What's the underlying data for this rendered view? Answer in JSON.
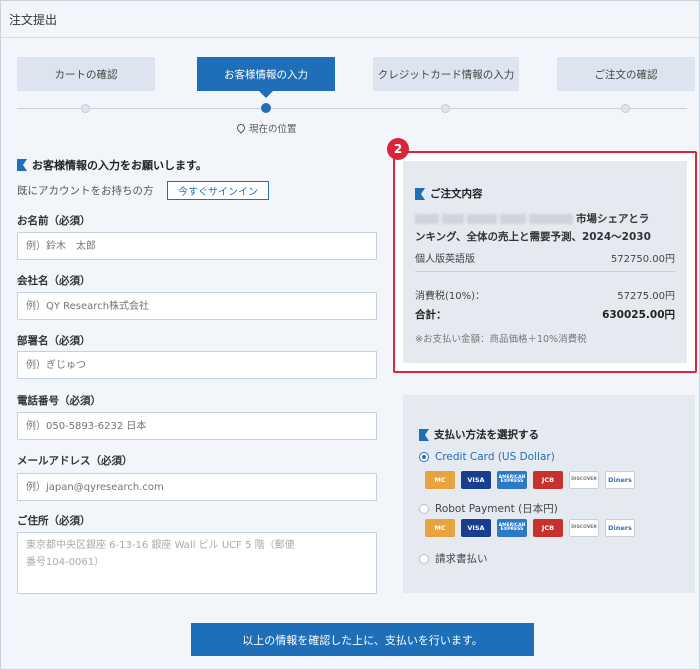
{
  "page": {
    "title": "注文提出"
  },
  "steps": [
    {
      "label": "カートの確認"
    },
    {
      "label": "お客様情報の入力"
    },
    {
      "label": "クレジットカード情報の入力"
    },
    {
      "label": "ご注文の確認"
    }
  ],
  "progress": {
    "current_label": "現在の位置",
    "current_step_index": 1
  },
  "customer": {
    "heading": "お客様情報の入力をお願いします。",
    "account_text": "既にアカウントをお持ちの方",
    "signin_label": "今すぐサインイン",
    "fields": {
      "name": {
        "label": "お名前（必須）",
        "placeholder": "例）鈴木　太郎"
      },
      "company": {
        "label": "会社名（必須）",
        "placeholder": "例）QY Research株式会社"
      },
      "department": {
        "label": "部署名（必須）",
        "placeholder": "例）ぎじゅつ"
      },
      "phone": {
        "label": "電話番号（必須）",
        "placeholder": "例）050-5893-6232 日本"
      },
      "email": {
        "label": "メールアドレス（必須）",
        "placeholder": "例）japan@qyresearch.com"
      },
      "address": {
        "label": "ご住所（必須）",
        "placeholder_line1": "東京都中央区銀座 6-13-16 銀座 Wall ビル UCF 5 階（郵便",
        "placeholder_line2": "番号104-0061）"
      }
    }
  },
  "order": {
    "badge": "2",
    "title": "ご注文内容",
    "product_line1_tail": "市場シェアとラ",
    "product_line2": "ンキング、全体の売上と需要予測、2024～2030",
    "edition_label": "個人版英語版",
    "edition_price": "572750.00円",
    "tax_label": "消費税(10%)：",
    "tax_value": "57275.00円",
    "total_label": "合計：",
    "total_value": "630025.00円",
    "note": "※お支払い金額：商品価格＋10%消費税"
  },
  "payment": {
    "heading": "支払い方法を選択する",
    "options": [
      {
        "label": "Credit Card (US Dollar)",
        "selected": true
      },
      {
        "label": "Robot Payment (日本円)",
        "selected": false
      },
      {
        "label": "請求書払い",
        "selected": false
      }
    ],
    "cards": [
      {
        "name": "mastercard-icon",
        "text": "MC",
        "color": "#e8a33c"
      },
      {
        "name": "visa-icon",
        "text": "VISA",
        "color": "#1a3d8f"
      },
      {
        "name": "amex-icon",
        "text": "AMERICAN EXPRESS",
        "color": "#2d79c7"
      },
      {
        "name": "jcb-icon",
        "text": "JCB",
        "color": "#c8302e"
      },
      {
        "name": "discover-icon",
        "text": "DISCOVER",
        "color": "#777777"
      },
      {
        "name": "diners-icon",
        "text": "Diners",
        "color": "#3a6fb0"
      }
    ]
  },
  "submit": {
    "label": "以上の情報を確認した上に、支払いを行います。"
  },
  "colors": {
    "accent": "#1f6fb8",
    "highlight": "#d9253a"
  }
}
